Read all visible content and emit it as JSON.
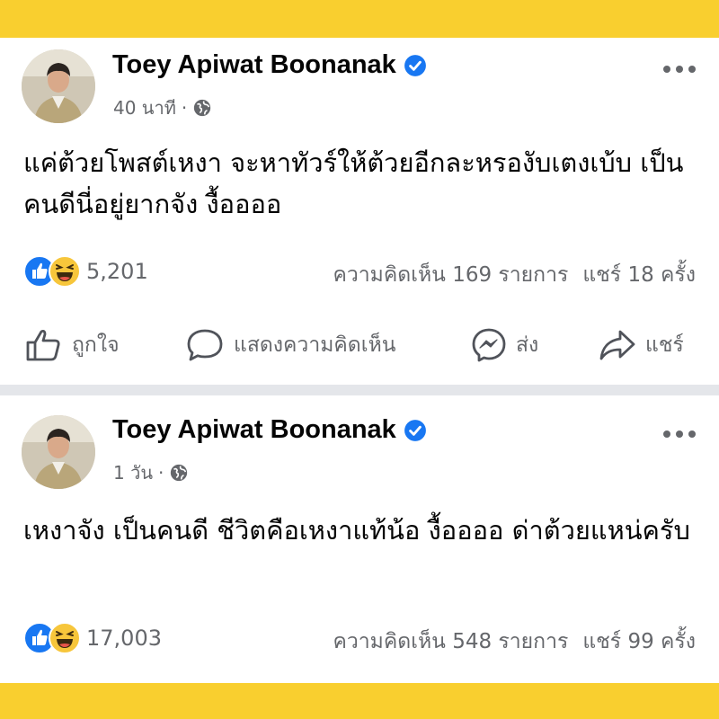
{
  "posts": [
    {
      "author": "Toey Apiwat Boonanak",
      "time": "40 นาที",
      "separator": "·",
      "text": "แค่ต้วยโพสต์เหงา จะหาทัวร์ให้ต้วยอีกละหรองับเตงเบ้บ เป็นคนดีนี่อยู่ยากจัง งื้ออออ",
      "reaction_count": "5,201",
      "comments": "ความคิดเห็น 169 รายการ",
      "shares": "แชร์ 18 ครั้ง",
      "actions": {
        "like": "ถูกใจ",
        "comment": "แสดงความคิดเห็น",
        "send": "ส่ง",
        "share": "แชร์"
      }
    },
    {
      "author": "Toey Apiwat Boonanak",
      "time": "1 วัน",
      "separator": "·",
      "text": "เหงาจัง เป็นคนดี ชีวิตคือเหงาแท้น้อ งื้ออออ ด่าต้วยแหน่ครับ",
      "reaction_count": "17,003",
      "comments": "ความคิดเห็น 548 รายการ",
      "shares": "แชร์ 99 ครั้ง"
    }
  ],
  "icons": {
    "verified": "verified-badge-icon",
    "globe": "globe-icon",
    "more": "more-options-icon",
    "reactions": [
      "like-reaction-icon",
      "haha-reaction-icon"
    ],
    "like": "thumbs-up-icon",
    "comment": "comment-bubble-icon",
    "send": "messenger-icon",
    "share": "share-arrow-icon"
  },
  "colors": {
    "frame": "#f9cf2f",
    "verified": "#1877f2",
    "secondary_text": "#65676b",
    "separator": "#e4e6ea"
  }
}
